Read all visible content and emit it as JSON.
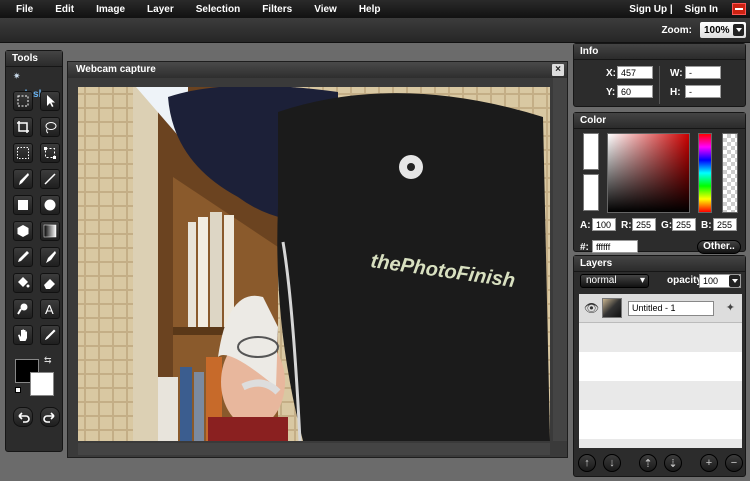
{
  "menu": [
    "File",
    "Edit",
    "Image",
    "Layer",
    "Selection",
    "Filters",
    "View",
    "Help"
  ],
  "auth": {
    "sign_up": "Sign Up |",
    "sign_in": "Sign In"
  },
  "zoom": {
    "label": "Zoom:",
    "value": "100%"
  },
  "tools_panel": {
    "title": "Tools",
    "logo": "splashup"
  },
  "canvas_window": {
    "title": "Webcam capture",
    "close": "×"
  },
  "info": {
    "title": "Info",
    "x_label": "X:",
    "x": "457",
    "y_label": "Y:",
    "y": "60",
    "w_label": "W:",
    "w": "-",
    "h_label": "H:",
    "h": "-"
  },
  "color": {
    "title": "Color",
    "a_label": "A:",
    "a": "100",
    "r_label": "R:",
    "r": "255",
    "g_label": "G:",
    "g": "255",
    "b_label": "B:",
    "b": "255",
    "hex_label": "#:",
    "hex": "ffffff",
    "other": "Other.."
  },
  "layers": {
    "title": "Layers",
    "blend_mode": "normal",
    "opacity_label": "opacity:",
    "opacity": "100",
    "items": [
      {
        "name": "Untitled - 1"
      }
    ]
  },
  "cap_text": "thePhotoFinish"
}
